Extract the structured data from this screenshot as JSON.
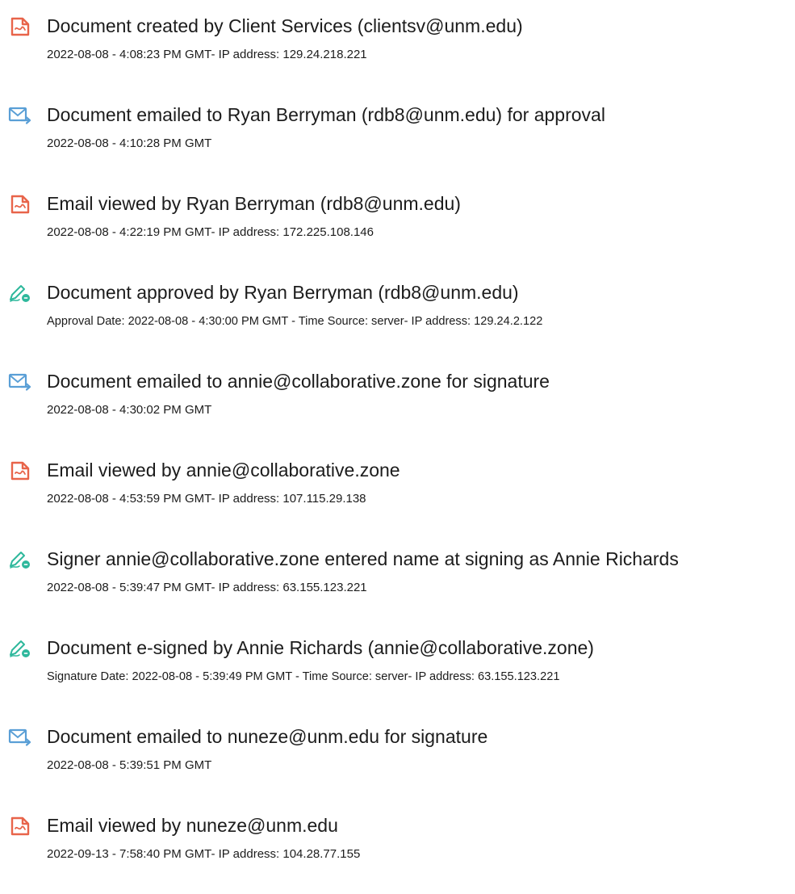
{
  "events": [
    {
      "icon": "document-icon",
      "title": "Document created by Client Services (clientsv@unm.edu)",
      "detail": "2022-08-08 - 4:08:23 PM GMT- IP address: 129.24.218.221"
    },
    {
      "icon": "email-sent-icon",
      "title": "Document emailed to Ryan Berryman (rdb8@unm.edu) for approval",
      "detail": "2022-08-08 - 4:10:28 PM GMT"
    },
    {
      "icon": "document-icon",
      "title": "Email viewed by Ryan Berryman (rdb8@unm.edu)",
      "detail": "2022-08-08 - 4:22:19 PM GMT- IP address: 172.225.108.146"
    },
    {
      "icon": "signature-pen-icon",
      "title": "Document approved by Ryan Berryman (rdb8@unm.edu)",
      "detail": "Approval Date: 2022-08-08 - 4:30:00 PM GMT - Time Source: server- IP address: 129.24.2.122"
    },
    {
      "icon": "email-sent-icon",
      "title": "Document emailed to annie@collaborative.zone for signature",
      "detail": "2022-08-08 - 4:30:02 PM GMT"
    },
    {
      "icon": "document-icon",
      "title": "Email viewed by annie@collaborative.zone",
      "detail": "2022-08-08 - 4:53:59 PM GMT- IP address: 107.115.29.138"
    },
    {
      "icon": "signature-pen-icon",
      "title": "Signer annie@collaborative.zone entered name at signing as Annie Richards",
      "detail": "2022-08-08 - 5:39:47 PM GMT- IP address: 63.155.123.221"
    },
    {
      "icon": "signature-pen-icon",
      "title": "Document e-signed by Annie Richards (annie@collaborative.zone)",
      "detail": "Signature Date: 2022-08-08 - 5:39:49 PM GMT - Time Source: server- IP address: 63.155.123.221"
    },
    {
      "icon": "email-sent-icon",
      "title": "Document emailed to nuneze@unm.edu for signature",
      "detail": "2022-08-08 - 5:39:51 PM GMT"
    },
    {
      "icon": "document-icon",
      "title": "Email viewed by nuneze@unm.edu",
      "detail": "2022-09-13 - 7:58:40 PM GMT- IP address: 104.28.77.155"
    }
  ],
  "colors": {
    "document_icon": "#e8644a",
    "email_icon": "#5a9fd6",
    "signature_icon": "#2eb89c"
  }
}
